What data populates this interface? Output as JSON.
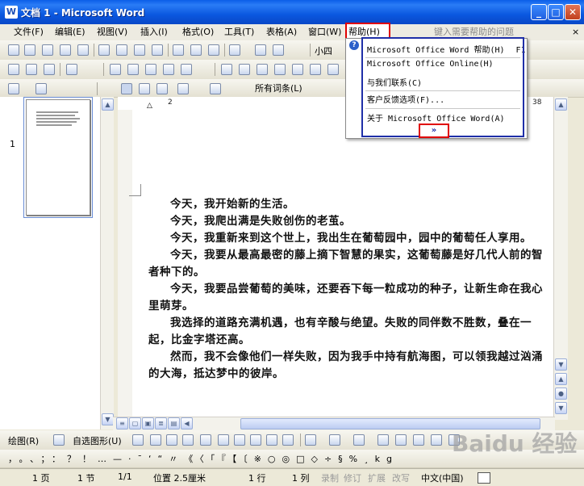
{
  "window": {
    "title": "文档 1 - Microsoft Word"
  },
  "menubar": {
    "items": [
      "文件(F)",
      "编辑(E)",
      "视图(V)",
      "插入(I)",
      "格式(O)",
      "工具(T)",
      "表格(A)",
      "窗口(W)",
      "帮助(H)"
    ],
    "ask_placeholder": "键入需要帮助的问题",
    "close": "×"
  },
  "toolbar_format": {
    "font_size": "小四"
  },
  "toolbar_review": {
    "markup_show": "所有词条(L)"
  },
  "help_menu": {
    "items": [
      {
        "label": "Microsoft Office Word 帮助(H)",
        "shortcut": "F1"
      },
      {
        "label": "Microsoft Office Online(H)"
      },
      {
        "label": "与我们联系(C)"
      },
      {
        "label": "客户反馈选项(F)..."
      },
      {
        "label": "关于 Microsoft Office Word(A)"
      }
    ],
    "expand": "»"
  },
  "ruler": {
    "numbers": [
      "2",
      "38"
    ]
  },
  "thumbnails": {
    "page_number": "1"
  },
  "document": {
    "paragraphs": [
      "今天，我开始新的生活。",
      "今天，我爬出满是失败创伤的老茧。",
      "今天，我重新来到这个世上，我出生在葡萄园中，园中的葡萄任人享用。",
      "今天，我要从最高最密的藤上摘下智慧的果实，这葡萄藤是好几代人前的智者种下的。",
      "今天，我要品尝葡萄的美味，还要吞下每一粒成功的种子，让新生命在我心里萌芽。",
      "我选择的道路充满机遇，也有辛酸与绝望。失败的同伴数不胜数，叠在一起，比金字塔还高。",
      "然而，我不会像他们一样失败，因为我手中持有航海图，可以领我越过汹涌的大海，抵达梦中的彼岸。"
    ]
  },
  "drawing_toolbar": {
    "draw": "绘图(R)",
    "autoshapes": "自选图形(U)"
  },
  "symbol_bar": {
    "symbols": "，。、；：？！…—·ˉ‘“〃《〈「『【〔※○◎□◇÷§%¸kg"
  },
  "statusbar": {
    "page": "1 页",
    "section": "1 节",
    "pages": "1/1",
    "position": "位置 2.5厘米",
    "line": "1 行",
    "column": "1 列",
    "rec": "录制",
    "trk": "修订",
    "ext": "扩展",
    "ovr": "改写",
    "lang": "中文(中国)"
  },
  "watermark": "Baidu 经验"
}
